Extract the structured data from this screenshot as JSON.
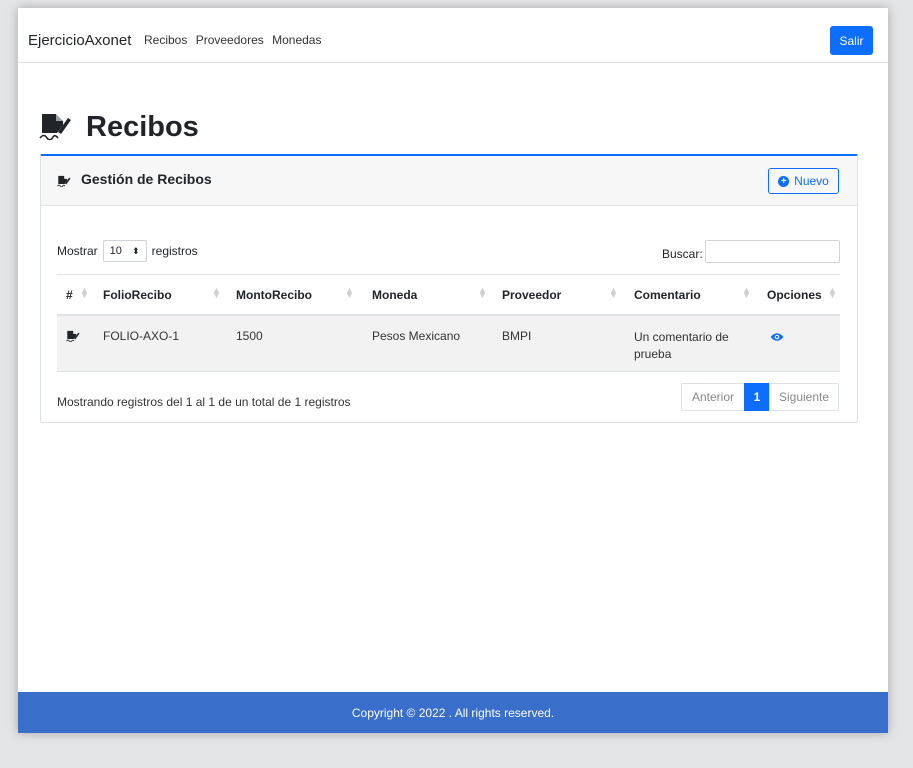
{
  "navbar": {
    "brand": "EjercicioAxonet",
    "links": [
      "Recibos",
      "Proveedores",
      "Monedas"
    ],
    "logout_label": "Salir"
  },
  "page": {
    "title": "Recibos",
    "title_icon": "signature-icon"
  },
  "card": {
    "title": "Gestión de Recibos",
    "title_icon": "signature-icon",
    "new_button_label": "Nuevo",
    "new_button_icon": "plus-circle-icon"
  },
  "table_controls": {
    "show_prefix": "Mostrar",
    "page_length": "10",
    "show_suffix": "registros",
    "search_label": "Buscar:",
    "search_value": ""
  },
  "table": {
    "columns": [
      "#",
      "FolioRecibo",
      "MontoRecibo",
      "Moneda",
      "Proveedor",
      "Comentario",
      "Opciones"
    ],
    "rows": [
      {
        "row_icon": "signature-icon",
        "folio": "FOLIO-AXO-1",
        "monto": "1500",
        "moneda": "Pesos Mexicano",
        "proveedor": "BMPI",
        "comentario": "Un comentario de prueba",
        "action_icon": "eye-icon"
      }
    ]
  },
  "footer_info": "Mostrando registros del 1 al 1 de un total de 1 registros",
  "pagination": {
    "prev": "Anterior",
    "current": "1",
    "next": "Siguiente"
  },
  "footer": {
    "copyright": "Copyright © 2022 . All rights reserved."
  },
  "colors": {
    "primary": "#0d6efd",
    "footer_bg": "#3a6ecb",
    "row_bg": "#f2f2f2"
  }
}
